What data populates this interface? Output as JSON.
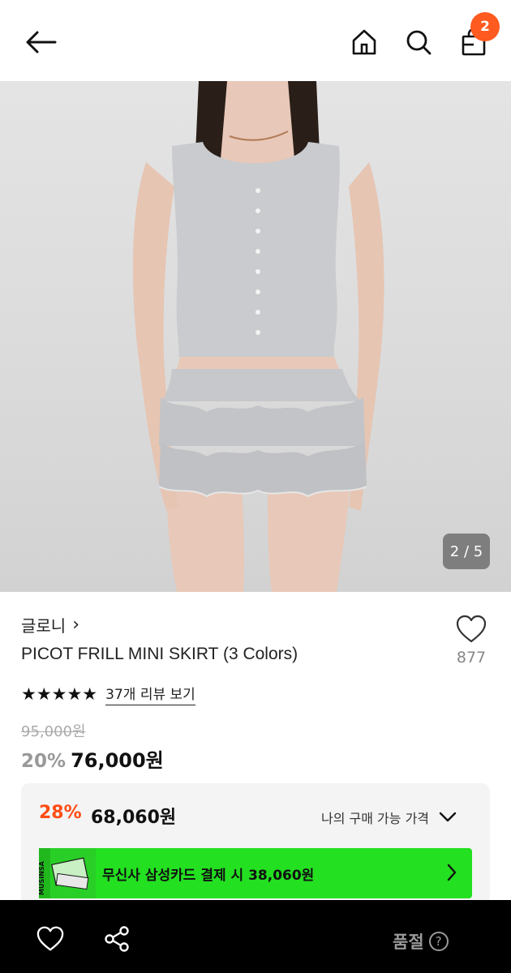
{
  "header": {
    "cart_count": "2",
    "back_icon": "arrow-left-icon",
    "home_icon": "home-icon",
    "search_icon": "search-icon",
    "cart_icon": "shopping-bag-icon"
  },
  "gallery": {
    "pager": "2 / 5"
  },
  "product": {
    "brand": "글로니",
    "brand_chevron": "›",
    "title": "PICOT FRILL MINI SKIRT (3 Colors)",
    "stars": "★★★★★",
    "review_link": "37개 리뷰 보기",
    "wish_count": "877",
    "original_price": "95,000원",
    "discount": "20%",
    "price": "76,000원"
  },
  "benefit": {
    "discount": "28%",
    "price": "68,060원",
    "label": "나의 구매 가능 가격",
    "card_text": "무신사 삼성카드 결제 시 38,060원",
    "card_logo_text": "MUSINSA"
  },
  "bottom_bar": {
    "soldout_label": "품절",
    "help_glyph": "?"
  },
  "colors": {
    "accent": "#ff5a1f",
    "card_green": "#23e021",
    "discount_orange": "#ff4d14"
  }
}
